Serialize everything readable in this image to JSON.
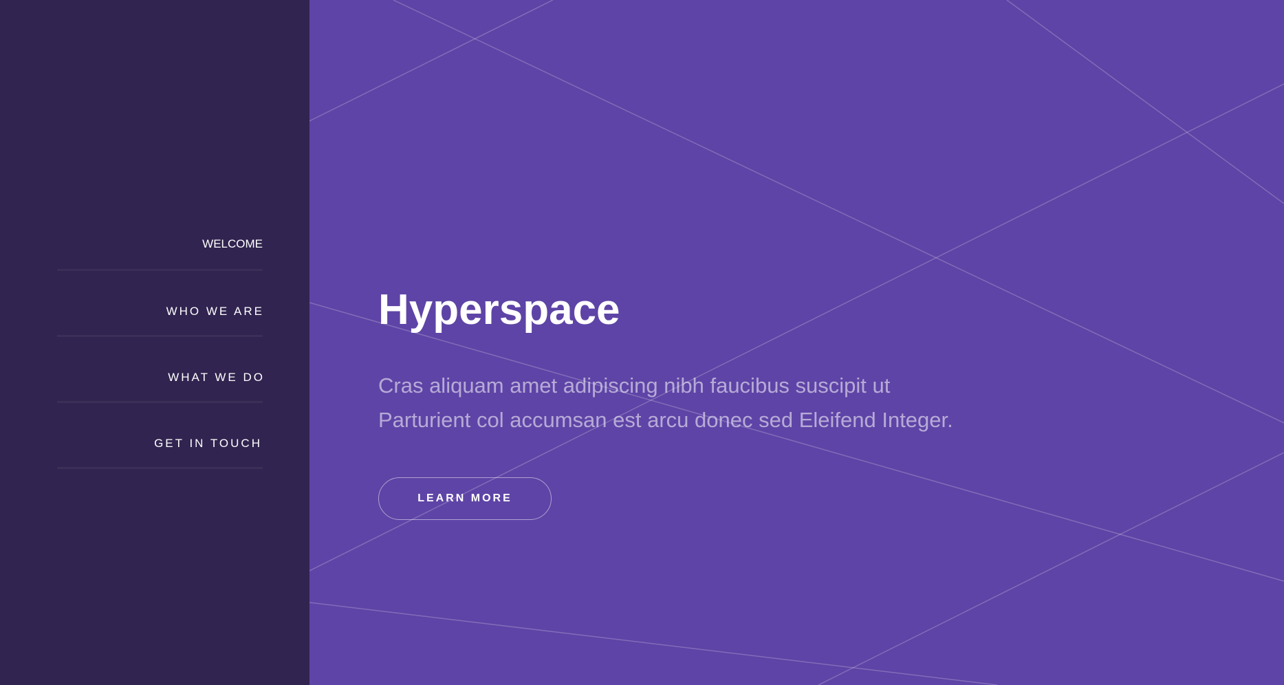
{
  "nav": {
    "items": [
      {
        "label": "WELCOME",
        "active": true
      },
      {
        "label": "WHO WE ARE",
        "active": false
      },
      {
        "label": "WHAT WE DO",
        "active": false
      },
      {
        "label": "GET IN TOUCH",
        "active": false
      }
    ]
  },
  "hero": {
    "title": "Hyperspace",
    "description": "Cras aliquam amet adipiscing nibh faucibus suscipit ut Parturient col accumsan est arcu donec sed Eleifend Integer.",
    "button_label": "LEARN MORE"
  },
  "colors": {
    "sidebar_bg": "#312450",
    "main_bg": "#5e44a6",
    "text": "#ffffff"
  }
}
